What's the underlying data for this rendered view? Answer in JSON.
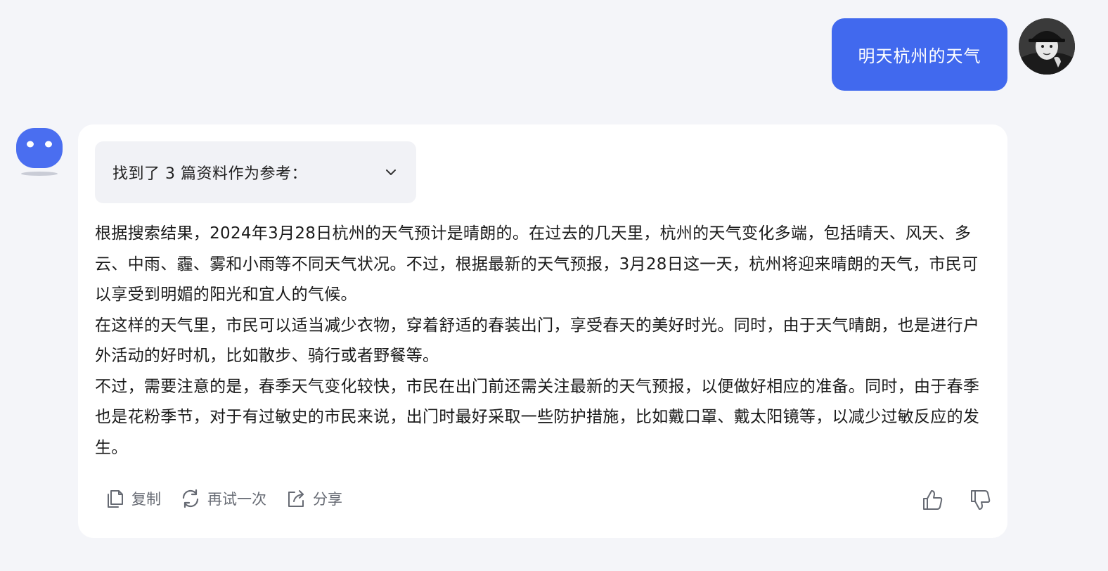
{
  "user_message": {
    "text": "明天杭州的天气"
  },
  "sources": {
    "label": "找到了 3 篇资料作为参考："
  },
  "answer": {
    "paragraphs": [
      "根据搜索结果，2024年3月28日杭州的天气预计是晴朗的。在过去的几天里，杭州的天气变化多端，包括晴天、风天、多云、中雨、霾、雾和小雨等不同天气状况。不过，根据最新的天气预报，3月28日这一天，杭州将迎来晴朗的天气，市民可以享受到明媚的阳光和宜人的气候。",
      "在这样的天气里，市民可以适当减少衣物，穿着舒适的春装出门，享受春天的美好时光。同时，由于天气晴朗，也是进行户外活动的好时机，比如散步、骑行或者野餐等。",
      "不过，需要注意的是，春季天气变化较快，市民在出门前还需关注最新的天气预报，以便做好相应的准备。同时，由于春季也是花粉季节，对于有过敏史的市民来说，出门时最好采取一些防护措施，比如戴口罩、戴太阳镜等，以减少过敏反应的发生。"
    ]
  },
  "actions": {
    "copy": "复制",
    "retry": "再试一次",
    "share": "分享"
  },
  "icons": {
    "copy": "copy-icon",
    "retry": "refresh-icon",
    "share": "share-icon",
    "like": "thumbs-up-icon",
    "dislike": "thumbs-down-icon",
    "expand": "chevron-down-icon"
  },
  "colors": {
    "accent": "#4169ee",
    "background": "#f4f5f9",
    "card": "#ffffff",
    "muted": "#666a73"
  }
}
